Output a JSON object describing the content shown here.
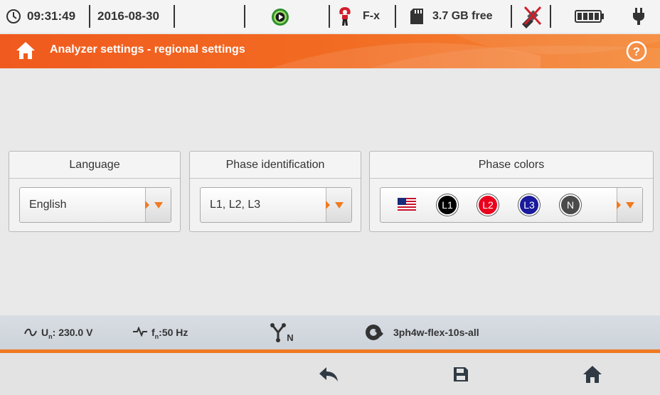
{
  "status": {
    "time": "09:31:49",
    "date": "2016-08-30",
    "clamp": "F-x",
    "storage": "3.7 GB free"
  },
  "header": {
    "title": "Analyzer settings - regional settings"
  },
  "panels": {
    "language": {
      "label": "Language",
      "value": "English"
    },
    "phase_identification": {
      "label": "Phase identification",
      "value": "L1, L2, L3"
    },
    "phase_colors": {
      "label": "Phase colors",
      "phases": [
        {
          "label": "L1",
          "color": "#000000"
        },
        {
          "label": "L2",
          "color": "#e8001c"
        },
        {
          "label": "L3",
          "color": "#1a1a9c"
        },
        {
          "label": "N",
          "color": "#4a4a4a"
        }
      ]
    }
  },
  "info": {
    "voltage": "230.0 V",
    "frequency": "50 Hz",
    "config": "3ph4w-flex-10s-all"
  },
  "colors": {
    "accent": "#f07a20"
  }
}
